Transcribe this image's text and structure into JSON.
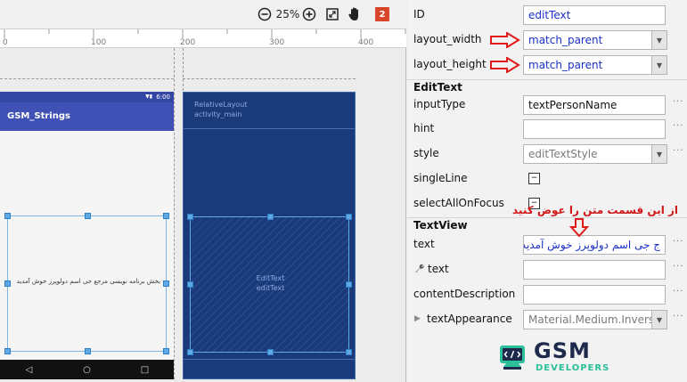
{
  "toolbar": {
    "zoom_out_icon": "minus-circle-icon",
    "zoom_level": "25%",
    "zoom_in_icon": "plus-circle-icon",
    "fit_icon": "fit-screen-icon",
    "pan_icon": "hand-icon",
    "error_count": "2"
  },
  "ruler": {
    "ticks": [
      "0",
      "100",
      "200",
      "300",
      "400"
    ]
  },
  "phone": {
    "status_time": "6:00",
    "app_title": "GSM_Strings",
    "edit_text_preview": "به بخش برنامه نویسی مرجع جی اسم دولوپرز خوش آمدید"
  },
  "blueprint": {
    "layout_name": "RelativeLayout",
    "layout_id": "activity_main",
    "widget_name": "EditText",
    "widget_id": "editText"
  },
  "props": {
    "id": {
      "label": "ID",
      "value": "editText"
    },
    "layout_width": {
      "label": "layout_width",
      "value": "match_parent"
    },
    "layout_height": {
      "label": "layout_height",
      "value": "match_parent"
    },
    "edittext_section": "EditText",
    "input_type": {
      "label": "inputType",
      "value": "textPersonName"
    },
    "hint": {
      "label": "hint",
      "value": ""
    },
    "style": {
      "label": "style",
      "value": "editTextStyle"
    },
    "single_line": {
      "label": "singleLine",
      "value": "−"
    },
    "select_all": {
      "label": "selectAllOnFocus",
      "value": "−"
    },
    "textview_section": "TextView",
    "text": {
      "label": "text",
      "value": "ج جی اسم دولوپرز خوش آمدید"
    },
    "tools_text": {
      "label": "text",
      "value": ""
    },
    "content_description": {
      "label": "contentDescription",
      "value": ""
    },
    "text_appearance": {
      "label": "textAppearance",
      "value": "Material.Medium.Inverse"
    }
  },
  "annotation": "از این قسمت متن را عوض کنید",
  "logo": {
    "brand": "GSM",
    "sub": "DEVELOPERS"
  },
  "colors": {
    "accent_red": "#e01b1b",
    "blueprint": "#1a3a7a",
    "app_bar": "#3f51b5"
  }
}
